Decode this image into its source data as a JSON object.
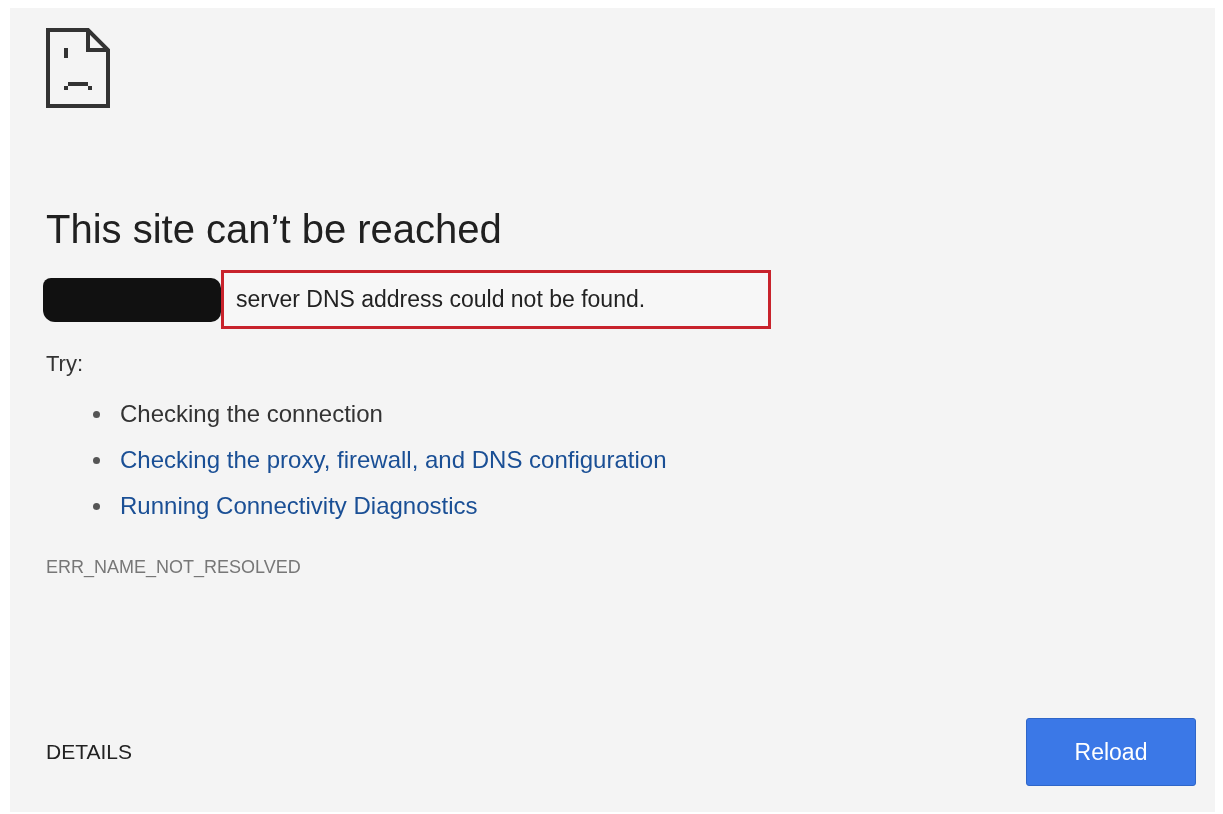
{
  "title": "This site can’t be reached",
  "message": {
    "text": "server DNS address could not be found.",
    "redacted_prefix": true,
    "highlighted": true
  },
  "try_label": "Try:",
  "suggestions": [
    {
      "text": "Checking the connection",
      "kind": "text"
    },
    {
      "text": "Checking the proxy, firewall, and DNS configuration",
      "kind": "link"
    },
    {
      "text": "Running Connectivity Diagnostics",
      "kind": "link"
    }
  ],
  "error_code": "ERR_NAME_NOT_RESOLVED",
  "details_button": "DETAILS",
  "reload_button": "Reload"
}
